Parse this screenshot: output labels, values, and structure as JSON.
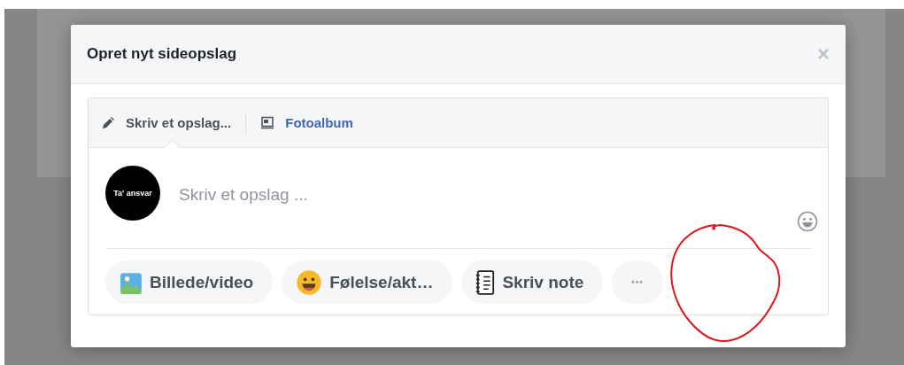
{
  "dialog": {
    "title": "Opret nyt sideopslag",
    "close": "×"
  },
  "tabs": [
    {
      "label": "Skriv et opslag...",
      "kind": "pencil",
      "selected": true
    },
    {
      "label": "Fotoalbum",
      "kind": "album",
      "selected": false
    }
  ],
  "composer": {
    "avatar_text": "Ta' ansvar",
    "placeholder": "Skriv et opslag ..."
  },
  "actions": [
    {
      "label": "Billede/video",
      "kind": "photo"
    },
    {
      "label": "Følelse/akt…",
      "kind": "emoji"
    },
    {
      "label": "Skriv note",
      "kind": "note"
    },
    {
      "label": "•••",
      "kind": "more"
    }
  ]
}
